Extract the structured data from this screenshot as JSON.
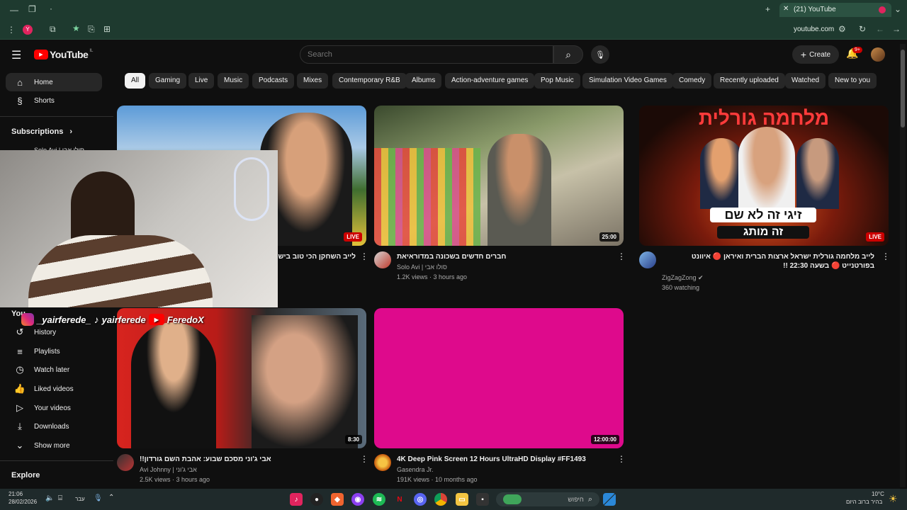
{
  "browser": {
    "tab_title": "(21) YouTube",
    "url": "youtube.com",
    "profile_initial": "Y"
  },
  "header": {
    "logo_text": "YouTube",
    "country_code": "IL",
    "search_placeholder": "Search",
    "create_label": "Create",
    "notification_count": "9+"
  },
  "chips": [
    "All",
    "Gaming",
    "Live",
    "Music",
    "Podcasts",
    "Mixes",
    "Contemporary R&B",
    "Albums",
    "Action-adventure games",
    "Pop Music",
    "Simulation Video Games",
    "Comedy",
    "Recently uploaded",
    "Watched",
    "New to you"
  ],
  "sidebar": {
    "home": "Home",
    "shorts": "Shorts",
    "subscriptions": "Subscriptions",
    "sub_channel": "Solo Avi | סולו אבי",
    "you": "You",
    "history": "History",
    "playlists": "Playlists",
    "watch_later": "Watch later",
    "liked": "Liked videos",
    "your_videos": "Your videos",
    "downloads": "Downloads",
    "show_more": "Show more",
    "explore": "Explore"
  },
  "overlay": {
    "instagram": "_yairferede_",
    "tiktok": "yairferede",
    "youtube": "FeredoX"
  },
  "videos": [
    {
      "title": "לייב השחקן הכי טוב בישראל",
      "channel": "",
      "meta": "",
      "badge": "LIVE"
    },
    {
      "title": "חברים חדשים בשכונה במדוראיאת",
      "channel": "Solo Avi | סולו אבי",
      "meta": "1.2K views · 3 hours ago",
      "badge": "25:00"
    },
    {
      "title": "לייב מלחמה גורלית ישראל ארצות הברית ואיראן 🔴 איוונט בפורטנייט 🔴 בשעה 22:30 !!",
      "channel": "ZigZagZong",
      "meta": "360 watching",
      "badge": "LIVE",
      "thumb_text_top": "מלחמה גורלית",
      "thumb_text_1": "זיגי זה לא שם",
      "thumb_text_2": "זה מותג"
    },
    {
      "title": "אבי ג'וני מסכם שבוע: אהבת השם גורדון!!",
      "channel": "Avi Johnny | אבי ג'וני",
      "meta": "2.5K views · 3 hours ago",
      "badge": "8:30"
    },
    {
      "title": "4K Deep Pink Screen 12 Hours UltraHD Display #FF1493",
      "channel": "Gasendra Jr.",
      "meta": "191K views · 10 months ago",
      "badge": "12:00:00"
    }
  ],
  "taskbar": {
    "time": "21:06",
    "date": "28/02/2026",
    "lang": "עבר",
    "search_placeholder": "חיפוש",
    "weather_temp": "10°C",
    "weather_desc": "בהיר ברוב היום"
  },
  "colors": {
    "pink": "#FF1493",
    "yt_red": "#ff0000",
    "chrome_green": "#1e3a2f"
  }
}
